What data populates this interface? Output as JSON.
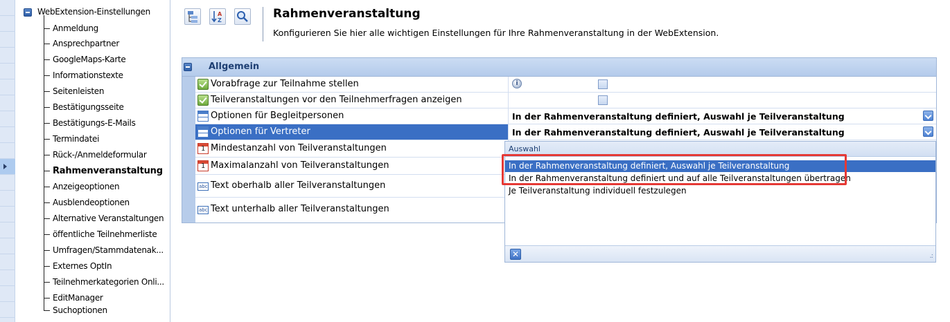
{
  "tree": {
    "root_label": "WebExtension-Einstellungen",
    "items": [
      "Anmeldung",
      "Ansprechpartner",
      "GoogleMaps-Karte",
      "Informationstexte",
      "Seitenleisten",
      "Bestätigungsseite",
      "Bestätigungs-E-Mails",
      "Termindatei",
      "Rück-/Anmeldeformular",
      "Rahmenveranstaltung",
      "Anzeigeoptionen",
      "Ausblendeoptionen",
      "Alternative Veranstaltungen",
      "öffentliche Teilnehmerliste",
      "Umfragen/Stammdatenak...",
      "Externes OptIn",
      "Teilnehmerkategorien Onli...",
      "EditManager",
      "Suchoptionen"
    ],
    "selected": "Rahmenveranstaltung"
  },
  "header": {
    "title": "Rahmenveranstaltung",
    "subtitle": "Konfigurieren Sie hier alle wichtigen Einstellungen für Ihre Rahmenveranstaltung in der WebExtension.",
    "toolbar_icons": [
      "categorized-view-icon",
      "sort-alphabetical-icon",
      "search-icon"
    ]
  },
  "grid": {
    "category": "Allgemein",
    "rows": [
      {
        "name": "Vorabfrage zur Teilnahme stellen",
        "icon": "checkbox-icon",
        "value": ""
      },
      {
        "name": "Teilveranstaltungen vor den Teilnehmerfragen anzeigen",
        "icon": "checkbox-icon",
        "value": ""
      },
      {
        "name": "Optionen für Begleitpersonen",
        "icon": "table-icon",
        "value": "In der Rahmenveranstaltung definiert, Auswahl je Teilveranstaltung"
      },
      {
        "name": "Optionen für Vertreter",
        "icon": "table-icon",
        "value": "In der Rahmenveranstaltung definiert, Auswahl je Teilveranstaltung"
      },
      {
        "name": "Mindestanzahl von Teilveranstaltungen",
        "icon": "calendar-icon",
        "value": ""
      },
      {
        "name": "Maximalanzahl von Teilveranstaltungen",
        "icon": "calendar-icon",
        "value": ""
      },
      {
        "name": "Text oberhalb aller Teilveranstaltungen",
        "icon": "text-field-icon",
        "value": ""
      },
      {
        "name": "Text unterhalb aller Teilveranstaltungen",
        "icon": "text-field-icon",
        "value": ""
      }
    ]
  },
  "popup": {
    "header": "Auswahl",
    "options": [
      "In der Rahmenveranstaltung definiert, Auswahl je Teilveranstaltung",
      "In der Rahmenveranstaltung definiert und auf alle Teilveranstaltungen übertragen",
      "Je Teilveranstaltung individuell festzulegen"
    ],
    "selected_index": 0,
    "close_glyph": "✕",
    "grip_glyph": ".:"
  },
  "colors": {
    "selection": "#3a6fc4",
    "highlight": "#e53935",
    "category_header": "#b4cbeb"
  }
}
